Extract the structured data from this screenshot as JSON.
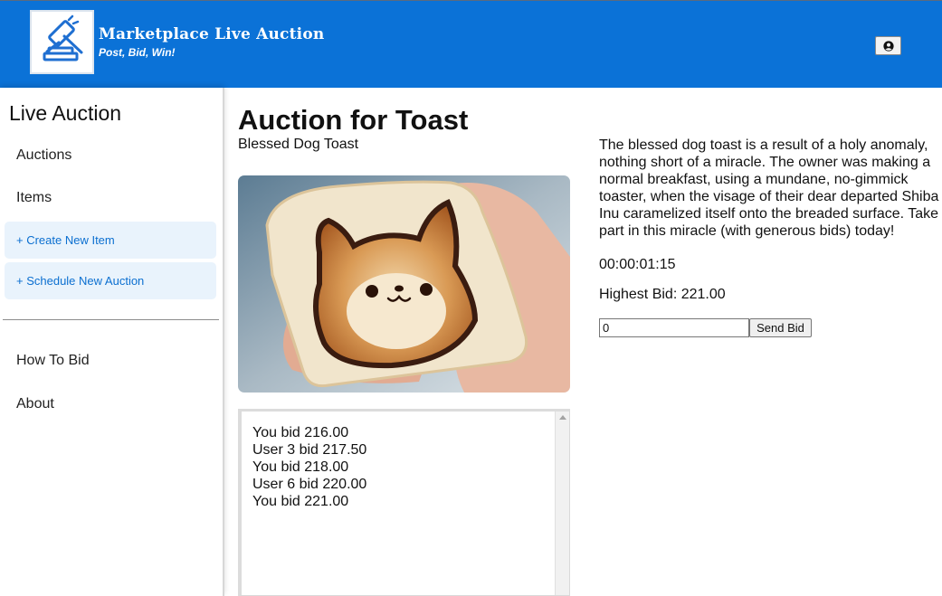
{
  "header": {
    "brand_title": "Marketplace Live Auction",
    "brand_tagline": "Post, Bid, Win!",
    "logo_icon": "gavel-icon",
    "account_icon": "user-circle-icon",
    "background_color": "#0b72d7"
  },
  "sidebar": {
    "title": "Live Auction",
    "items": [
      {
        "label": "Auctions"
      },
      {
        "label": "Items"
      }
    ],
    "actions": [
      {
        "label": "+ Create New Item"
      },
      {
        "label": "+ Schedule New Auction"
      }
    ],
    "footer_items": [
      {
        "label": "How To Bid"
      },
      {
        "label": "About"
      }
    ]
  },
  "auction": {
    "title": "Auction for Toast",
    "item_name": "Blessed Dog Toast",
    "description": "The blessed dog toast is a result of a holy anomaly, nothing short of a miracle. The owner was making a normal breakfast, using a mundane, no-gimmick toaster, when the visage of their dear departed Shiba Inu caramelized itself onto the breaded surface. Take part in this miracle (with generous bids) today!",
    "countdown": "00:00:01:15",
    "highest_bid": "Highest Bid: 221.00",
    "bid_input_value": "0",
    "send_bid_label": "Send Bid",
    "bid_log": [
      "You bid 216.00",
      "User 3 bid 217.50",
      "You bid 218.00",
      "User 6 bid 220.00",
      "You bid 221.00"
    ]
  },
  "colors": {
    "accent": "#0b72d7",
    "action_bg": "#e9f3fc",
    "action_text": "#0b6fd0"
  }
}
